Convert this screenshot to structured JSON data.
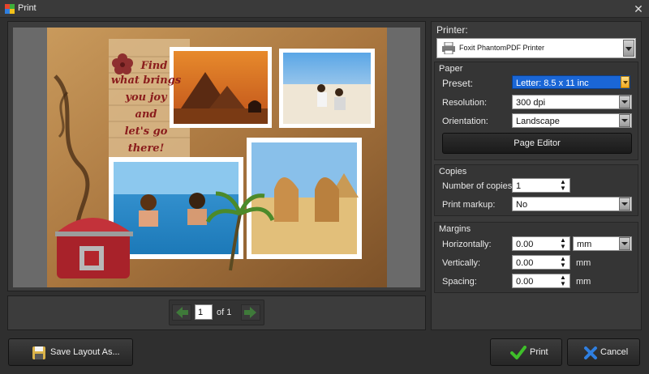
{
  "window": {
    "title": "Print",
    "close_glyph": "✕"
  },
  "preview": {
    "collage_text": [
      "Find",
      "what brings",
      "you joy",
      "and",
      "let's go",
      "there!"
    ],
    "page_current": "1",
    "page_total_text": "of 1"
  },
  "printer": {
    "label": "Printer:",
    "selected": "Foxit PhantomPDF Printer"
  },
  "paper": {
    "title": "Paper",
    "preset_label": "Preset:",
    "preset_value": "Letter: 8.5 x 11 inc",
    "resolution_label": "Resolution:",
    "resolution_value": "300 dpi",
    "orientation_label": "Orientation:",
    "orientation_value": "Landscape",
    "page_editor_label": "Page Editor"
  },
  "copies": {
    "title": "Copies",
    "number_label": "Number of copies:",
    "number_value": "1",
    "markup_label": "Print markup:",
    "markup_value": "No"
  },
  "margins": {
    "title": "Margins",
    "horizontal_label": "Horizontally:",
    "horizontal_value": "0.00",
    "unit_select": "mm",
    "vertical_label": "Vertically:",
    "vertical_value": "0.00",
    "vertical_unit": "mm",
    "spacing_label": "Spacing:",
    "spacing_value": "0.00",
    "spacing_unit": "mm"
  },
  "buttons": {
    "save_layout": "Save Layout As...",
    "print": "Print",
    "cancel": "Cancel"
  },
  "colors": {
    "accent_select": "#1a66d6",
    "green_check": "#3fbf2a",
    "blue_x": "#2f7fe0"
  }
}
